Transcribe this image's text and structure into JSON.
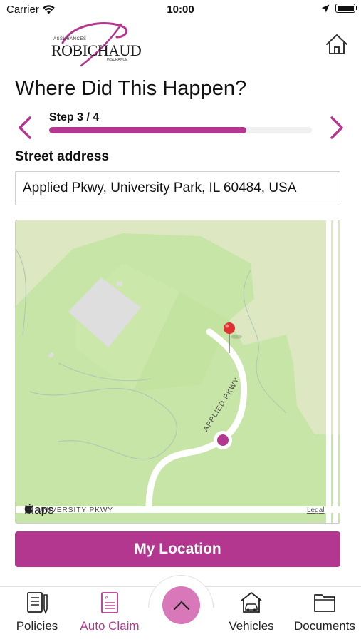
{
  "status_bar": {
    "carrier": "Carrier",
    "time": "10:00"
  },
  "header": {
    "logo": {
      "name": "ROBICHAUD",
      "top_text": "ASSURANCES",
      "bottom_text": "INSURANCE",
      "color": "#b3378f"
    },
    "home_icon": "home-icon"
  },
  "page": {
    "title": "Where Did This Happen?"
  },
  "stepper": {
    "label": "Step 3 / 4",
    "progress": 0.75,
    "prev_icon": "chevron-left-icon",
    "next_icon": "chevron-right-icon"
  },
  "address": {
    "label": "Street address",
    "value": "Applied Pkwy, University Park, IL 60484, USA"
  },
  "map": {
    "road_label_1": "APPLIED PKWY",
    "road_label_2": "UNIVERSITY PKWY",
    "brand": "Maps",
    "legal": "Legal"
  },
  "actions": {
    "my_location": "My Location"
  },
  "tab_bar": {
    "items": [
      {
        "label": "Policies",
        "icon": "policies-icon"
      },
      {
        "label": "Auto Claim",
        "icon": "auto-claim-icon",
        "active": true
      },
      {
        "label": "Vehicles",
        "icon": "vehicles-icon"
      },
      {
        "label": "Documents",
        "icon": "documents-icon"
      }
    ],
    "center_icon": "chevron-up-icon"
  },
  "colors": {
    "accent": "#b3378f",
    "fab": "#d978b8",
    "map_green": "#c8e6a6"
  }
}
